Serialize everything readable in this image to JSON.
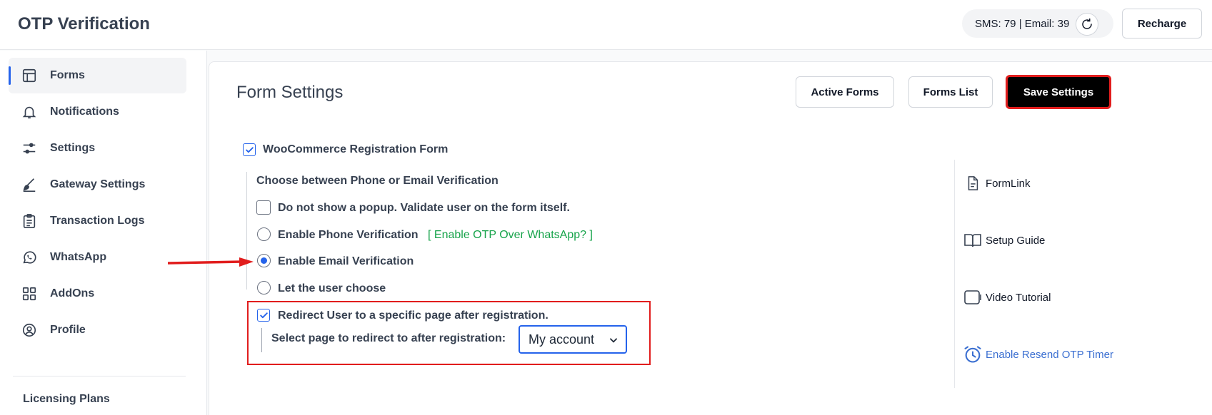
{
  "header": {
    "title": "OTP Verification",
    "credits": "SMS: 79 | Email: 39",
    "recharge_label": "Recharge"
  },
  "sidebar": {
    "items": [
      {
        "label": "Forms",
        "icon": "layout-icon"
      },
      {
        "label": "Notifications",
        "icon": "bell-icon"
      },
      {
        "label": "Settings",
        "icon": "sliders-icon"
      },
      {
        "label": "Gateway Settings",
        "icon": "brush-icon"
      },
      {
        "label": "Transaction Logs",
        "icon": "clipboard-list-icon"
      },
      {
        "label": "WhatsApp",
        "icon": "whatsapp-icon"
      },
      {
        "label": "AddOns",
        "icon": "grid-icon"
      },
      {
        "label": "Profile",
        "icon": "user-circle-icon"
      }
    ],
    "licensing": "Licensing Plans"
  },
  "main": {
    "title": "Form Settings",
    "buttons": {
      "active_forms": "Active Forms",
      "forms_list": "Forms List",
      "save_settings": "Save Settings"
    },
    "form_name": "WooCommerce Registration Form",
    "choose_label": "Choose between Phone or Email Verification",
    "options": {
      "no_popup": "Do not show a popup. Validate user on the form itself.",
      "phone": "Enable Phone Verification",
      "whatsapp_link": "[ Enable OTP Over WhatsApp? ]",
      "email": "Enable Email Verification",
      "user_choose": "Let the user choose"
    },
    "redirect": {
      "label": "Redirect User to a specific page after registration.",
      "select_label": "Select page to redirect to after registration:",
      "selected_page": "My account"
    }
  },
  "side_links": {
    "formlink": "FormLink",
    "setup_guide": "Setup Guide",
    "video_tutorial": "Video Tutorial",
    "resend_timer": "Enable Resend OTP Timer"
  },
  "colors": {
    "accent": "#2563eb",
    "highlight": "#e11d1d",
    "link_green": "#16a34a",
    "link_blue": "#3b6fd1"
  }
}
